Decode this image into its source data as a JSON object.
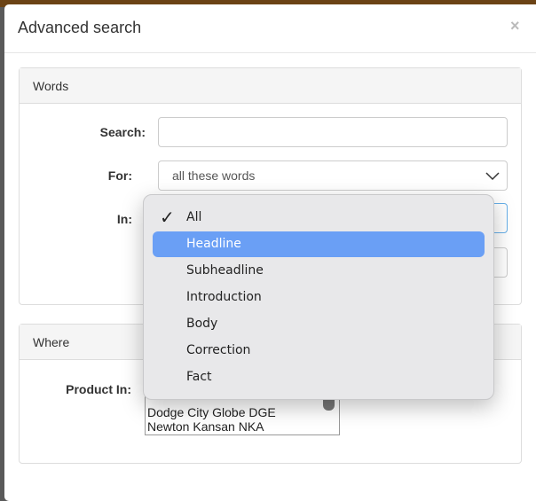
{
  "modal": {
    "title": "Advanced search",
    "close_label": "×"
  },
  "words": {
    "heading": "Words",
    "search_label": "Search:",
    "search_value": "",
    "for_label": "For:",
    "for_value": "all these words",
    "in_label": "In:"
  },
  "dropdown": {
    "options": [
      "All",
      "Headline",
      "Subheadline",
      "Introduction",
      "Body",
      "Correction",
      "Fact"
    ],
    "checked": "All",
    "highlighted": "Headline"
  },
  "where": {
    "heading": "Where",
    "product_label": "Product In:",
    "products": [
      "Dodge City Globe DGE",
      "Newton Kansan NKA"
    ]
  }
}
